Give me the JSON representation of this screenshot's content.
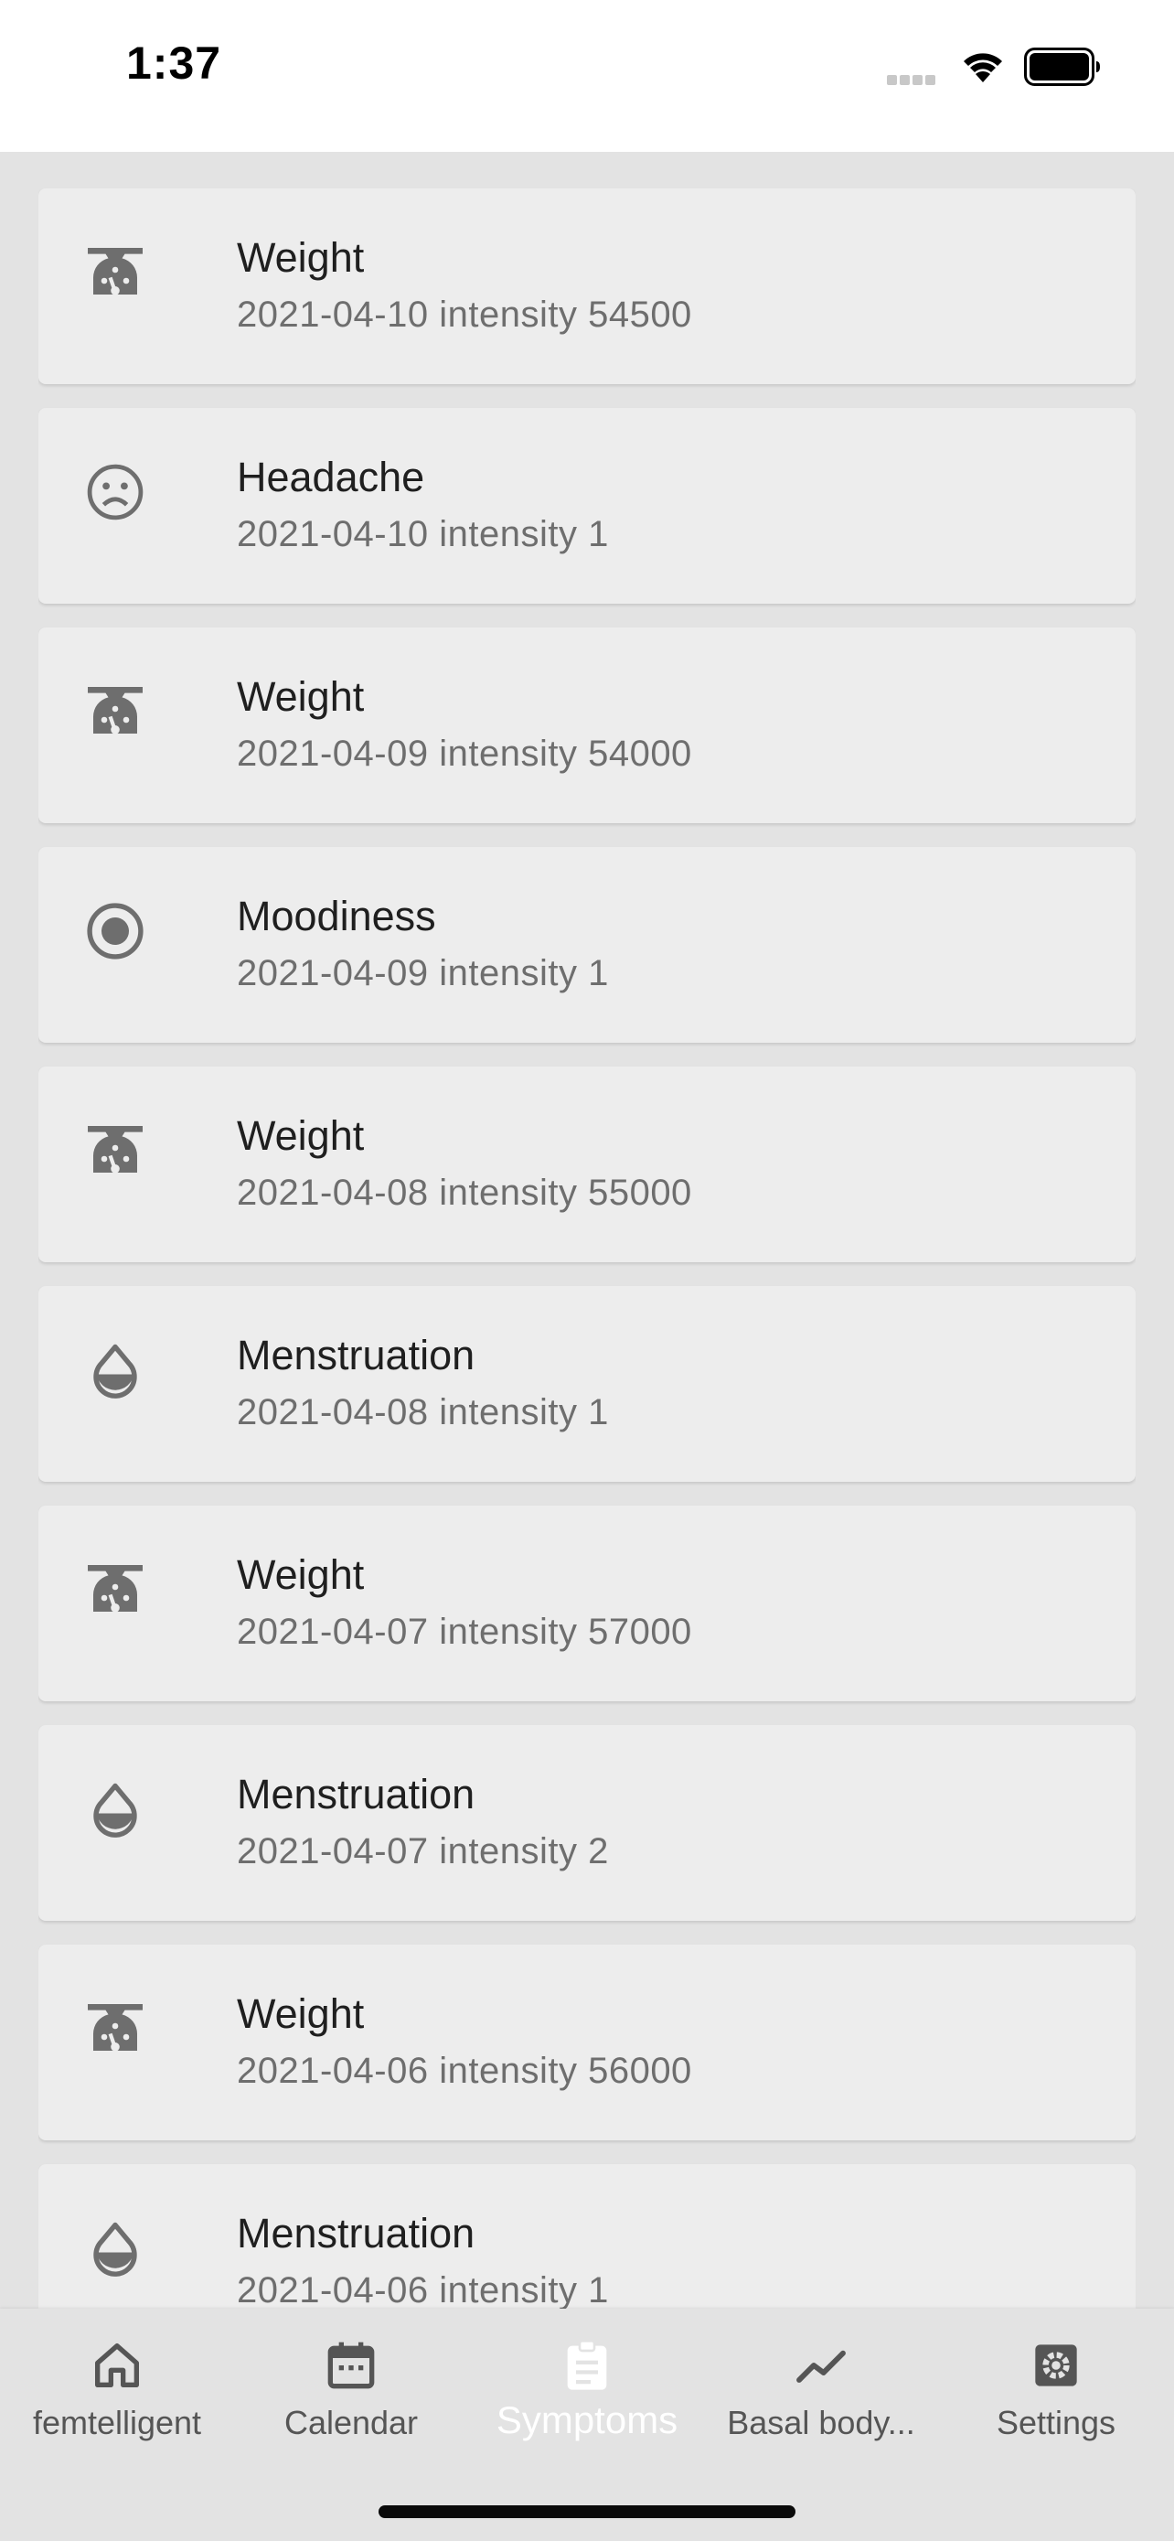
{
  "status_bar": {
    "time": "1:37"
  },
  "records": [
    {
      "icon": "scale-icon",
      "title": "Weight",
      "subtitle": "2021-04-10 intensity 54500"
    },
    {
      "icon": "sad-face-icon",
      "title": "Headache",
      "subtitle": "2021-04-10 intensity 1"
    },
    {
      "icon": "scale-icon",
      "title": "Weight",
      "subtitle": "2021-04-09 intensity 54000"
    },
    {
      "icon": "radio-button-icon",
      "title": "Moodiness",
      "subtitle": "2021-04-09 intensity 1"
    },
    {
      "icon": "scale-icon",
      "title": "Weight",
      "subtitle": "2021-04-08 intensity 55000"
    },
    {
      "icon": "drop-icon",
      "title": "Menstruation",
      "subtitle": "2021-04-08 intensity 1"
    },
    {
      "icon": "scale-icon",
      "title": "Weight",
      "subtitle": "2021-04-07 intensity 57000"
    },
    {
      "icon": "drop-icon",
      "title": "Menstruation",
      "subtitle": "2021-04-07 intensity 2"
    },
    {
      "icon": "scale-icon",
      "title": "Weight",
      "subtitle": "2021-04-06 intensity 56000"
    },
    {
      "icon": "drop-icon",
      "title": "Menstruation",
      "subtitle": "2021-04-06 intensity 1"
    }
  ],
  "tabs": [
    {
      "label": "femtelligent",
      "icon": "home-icon"
    },
    {
      "label": "Calendar",
      "icon": "calendar-icon"
    },
    {
      "label": "Symptoms",
      "icon": "clipboard-icon",
      "active": true
    },
    {
      "label": "Basal body...",
      "icon": "trend-line-icon"
    },
    {
      "label": "Settings",
      "icon": "settings-icon"
    }
  ],
  "colors": {
    "icon": "#6e6e6e",
    "active_tab": "#ffffff",
    "background": "#e3e3e3",
    "card": "#ededed"
  }
}
